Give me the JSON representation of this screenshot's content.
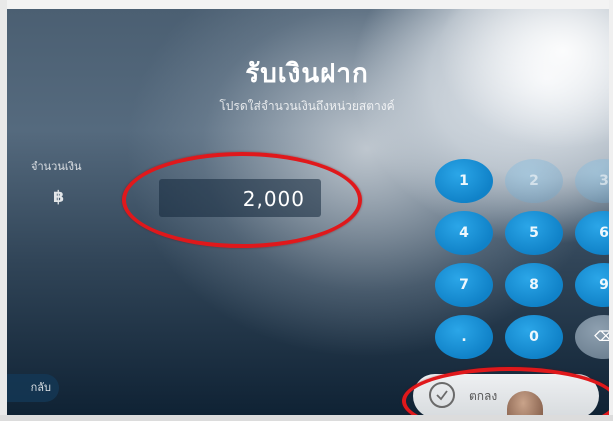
{
  "screen": {
    "title": "รับเงินฝาก",
    "subtitle": "โปรดใส่จำนวนเงินถึงหน่วยสตางค์"
  },
  "amount": {
    "label": "จำนวนเงิน",
    "currency_symbol": "฿",
    "value": "2,000"
  },
  "keypad": {
    "keys": [
      "1",
      "2",
      "3",
      "4",
      "5",
      "6",
      "7",
      "8",
      "9",
      ".",
      "0",
      "⌫"
    ]
  },
  "buttons": {
    "back_label": "กลับ",
    "ok_label": "ตกลง"
  },
  "colors": {
    "keypad_blue": "#1a95dc",
    "annotation_red": "#e0181b",
    "ok_button": "#e6e9eb"
  },
  "icons": {
    "backspace": "backspace-icon",
    "confirm": "check-circle-icon"
  }
}
